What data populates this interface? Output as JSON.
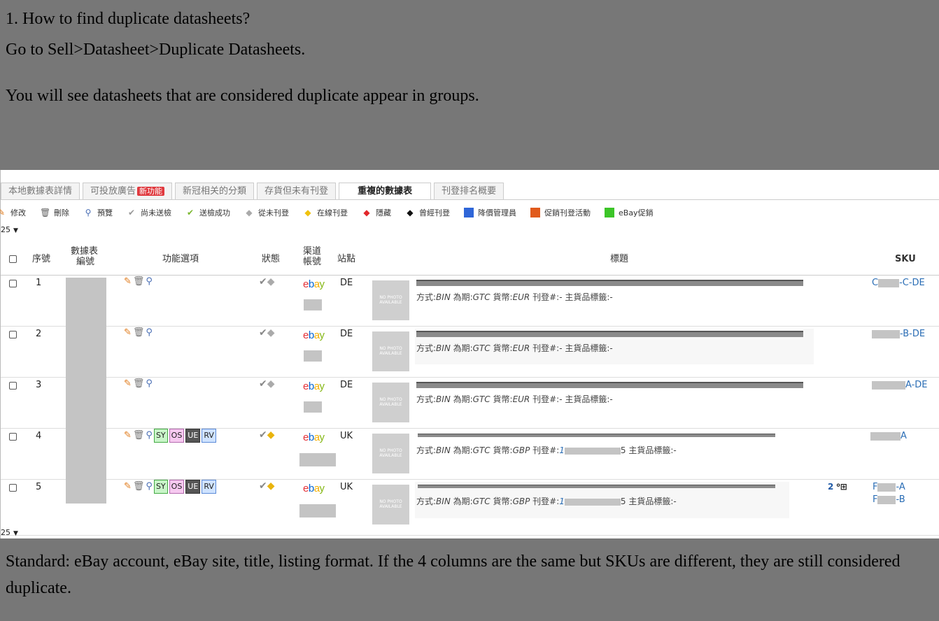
{
  "note_top": {
    "line1": "1. How to find duplicate datasheets?",
    "line2": "Go to Sell>Datasheet>Duplicate Datasheets.",
    "line3": "You will see datasheets that are considered duplicate appear in groups."
  },
  "note_bottom": {
    "text": "Standard: eBay account, eBay site, title, listing format. If the 4 columns are the same but SKUs are different, they are still considered duplicate."
  },
  "tabs": [
    {
      "label": "本地數據表詳情"
    },
    {
      "label": "可投放廣告",
      "badge": "新功能"
    },
    {
      "label": "新冠相关的分類"
    },
    {
      "label": "存貨但未有刊登"
    },
    {
      "label": "重複的數據表",
      "active": true
    },
    {
      "label": "刊登排名概要"
    }
  ],
  "toolbar": {
    "edit": "修改",
    "delete": "刪除",
    "preview": "預覽",
    "not_sent": "尚未送檢",
    "sent_ok": "送檢成功",
    "never_listed": "從未刊登",
    "online": "在線刊登",
    "hidden": "隱藏",
    "once_listed": "曾經刊登",
    "price_manager": "降價管理員",
    "promo": "促銷刊登活動",
    "ebay_promo": "eBay促銷",
    "colors": {
      "price_manager": "#2f66d8",
      "promo": "#e05a1c",
      "ebay_promo": "#3cc528"
    }
  },
  "pager": {
    "value": "25"
  },
  "headers": {
    "index": "序號",
    "datasheet_no_1": "數據表",
    "datasheet_no_2": "編號",
    "functions": "功能選項",
    "status": "狀態",
    "channel_1": "渠道",
    "channel_2": "帳號",
    "site": "站點",
    "title": "標題",
    "sku": "SKU"
  },
  "no_photo": {
    "line1": "NO PHOTO",
    "line2": "AVAILABLE"
  },
  "ebay_logo": {
    "e": "e",
    "b": "b",
    "a": "a",
    "y": "y"
  },
  "meta_labels": {
    "format": "方式:",
    "duration": "為期:",
    "currency": "貨幣:",
    "listing": "刊登#:",
    "main_tag": "主貨品標籤:-"
  },
  "function_tags": {
    "sy": "SY",
    "os": "OS",
    "ue": "UE",
    "rv": "RV"
  },
  "rows": [
    {
      "idx": "1",
      "site": "DE",
      "format": "BIN",
      "duration": "GTC",
      "currency": "EUR",
      "listing": "-",
      "listing_tail": "",
      "sku": "-C-DE",
      "sku_prefix_visible": "C",
      "status_listed": false
    },
    {
      "idx": "2",
      "site": "DE",
      "format": "BIN",
      "duration": "GTC",
      "currency": "EUR",
      "listing": "-",
      "listing_tail": "",
      "sku": "-B-DE",
      "status_listed": false
    },
    {
      "idx": "3",
      "site": "DE",
      "format": "BIN",
      "duration": "GTC",
      "currency": "EUR",
      "listing": "-",
      "listing_tail": "",
      "sku": "A-DE",
      "status_listed": false
    },
    {
      "idx": "4",
      "site": "UK",
      "format": "BIN",
      "duration": "GTC",
      "currency": "GBP",
      "listing": "1",
      "listing_tail": "5",
      "sku": "A",
      "status_listed": true
    },
    {
      "idx": "5",
      "site": "UK",
      "format": "BIN",
      "duration": "GTC",
      "currency": "GBP",
      "listing": "1",
      "listing_tail": "5",
      "sku": "-A",
      "sku2": "-B",
      "sku_prefix_visible": "F",
      "extra": "2",
      "status_listed": true
    }
  ]
}
